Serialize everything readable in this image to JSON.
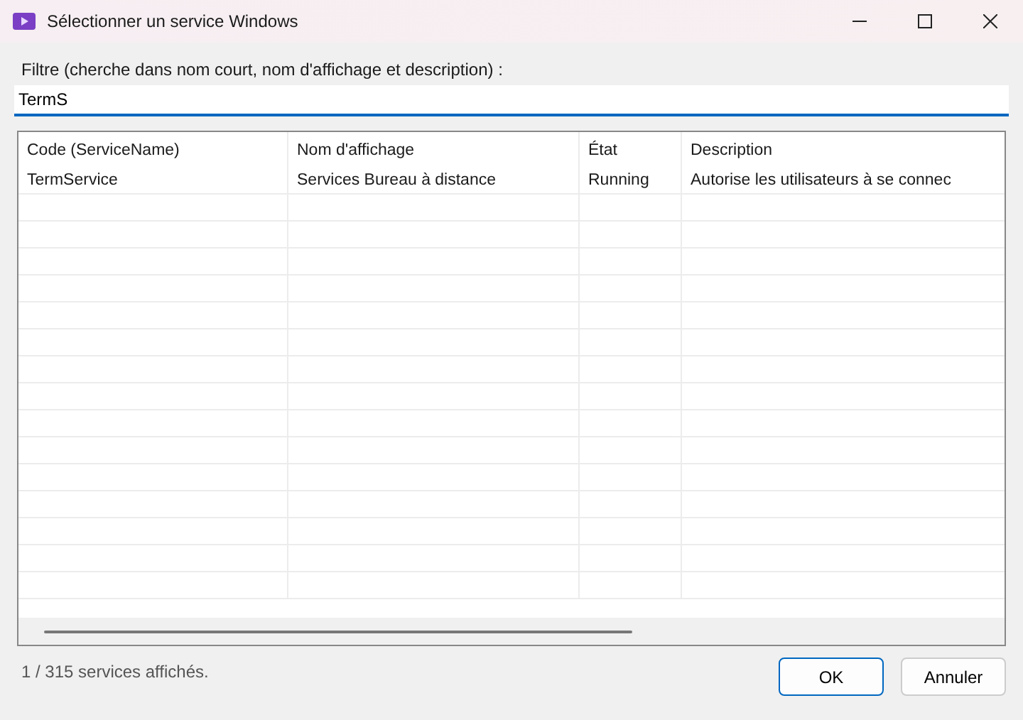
{
  "window": {
    "title": "Sélectionner un service Windows"
  },
  "filter": {
    "label": "Filtre (cherche dans nom court, nom d'affichage et description) :",
    "value": "TermS"
  },
  "table": {
    "columns": [
      "Code (ServiceName)",
      "Nom d'affichage",
      "État",
      "Description"
    ],
    "rows": [
      [
        "TermService",
        "Services Bureau à distance",
        "Running",
        "Autorise les utilisateurs à se connec"
      ]
    ]
  },
  "status": "1 / 315 services affichés.",
  "buttons": [
    {
      "label": "OK",
      "default": true
    },
    {
      "label": "Annuler",
      "default": false
    }
  ]
}
